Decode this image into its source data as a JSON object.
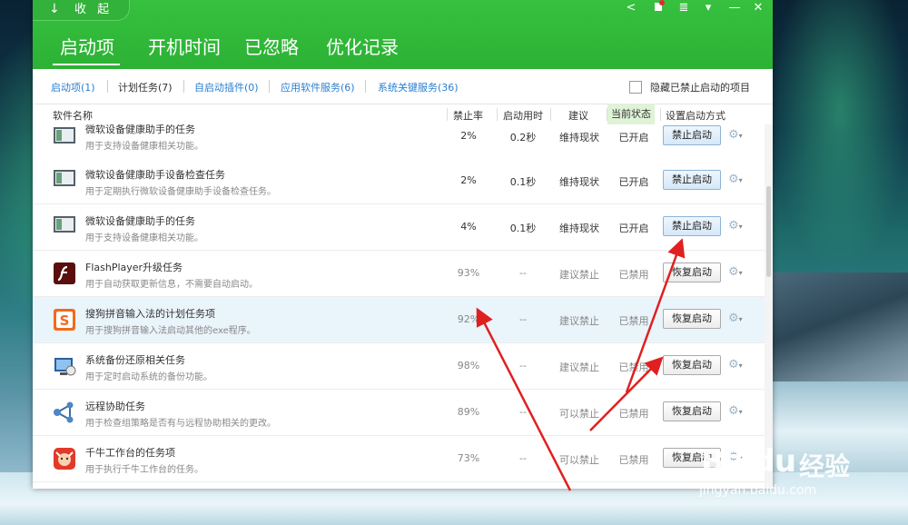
{
  "header": {
    "collapse_label": "收 起",
    "tabs": [
      {
        "label": "启动项"
      },
      {
        "label": "开机时间"
      },
      {
        "label": "已忽略"
      },
      {
        "label": "优化记录"
      }
    ],
    "controls": [
      "<",
      "",
      "≡",
      "▼",
      "—",
      "✕"
    ]
  },
  "filters": {
    "items": [
      {
        "label": "启动项(1)"
      },
      {
        "label": "计划任务(7)"
      },
      {
        "label": "自启动插件(0)"
      },
      {
        "label": "应用软件服务(6)"
      },
      {
        "label": "系统关键服务(36)"
      }
    ],
    "hide_checkbox_label": "隐藏已禁止启动的项目"
  },
  "columns": {
    "name": "软件名称",
    "ban_rate": "禁止率",
    "boot_time": "启动用时",
    "advice": "建议",
    "status": "当前状态",
    "action": "设置启动方式"
  },
  "rows": [
    {
      "title": "微软设备健康助手的任务",
      "desc": "用于支持设备健康相关功能。",
      "rate": "2%",
      "time": "0.2秒",
      "advice": "维持现状",
      "status": "已开启",
      "button": "禁止启动",
      "icon": "monitor-icon",
      "enabled": true
    },
    {
      "title": "微软设备健康助手设备检查任务",
      "desc": "用于定期执行微软设备健康助手设备检查任务。",
      "rate": "2%",
      "time": "0.1秒",
      "advice": "维持现状",
      "status": "已开启",
      "button": "禁止启动",
      "icon": "monitor-icon",
      "enabled": true
    },
    {
      "title": "微软设备健康助手的任务",
      "desc": "用于支持设备健康相关功能。",
      "rate": "4%",
      "time": "0.1秒",
      "advice": "维持现状",
      "status": "已开启",
      "button": "禁止启动",
      "icon": "monitor-icon",
      "enabled": true
    },
    {
      "title": "FlashPlayer升级任务",
      "desc": "用于自动获取更新信息，不需要自动启动。",
      "rate": "93%",
      "time": "--",
      "advice": "建议禁止",
      "status": "已禁用",
      "button": "恢复启动",
      "icon": "flash-icon",
      "enabled": false
    },
    {
      "title": "搜狗拼音输入法的计划任务项",
      "desc": "用于搜狗拼音输入法启动其他的exe程序。",
      "rate": "92%",
      "time": "--",
      "advice": "建议禁止",
      "status": "已禁用",
      "button": "恢复启动",
      "icon": "sogou-icon",
      "enabled": false
    },
    {
      "title": "系统备份还原相关任务",
      "desc": "用于定时启动系统的备份功能。",
      "rate": "98%",
      "time": "--",
      "advice": "建议禁止",
      "status": "已禁用",
      "button": "恢复启动",
      "icon": "backup-icon",
      "enabled": false
    },
    {
      "title": "远程协助任务",
      "desc": "用于检查组策略是否有与远程协助相关的更改。",
      "rate": "89%",
      "time": "--",
      "advice": "可以禁止",
      "status": "已禁用",
      "button": "恢复启动",
      "icon": "network-icon",
      "enabled": false
    },
    {
      "title": "千牛工作台的任务项",
      "desc": "用于执行千牛工作台的任务。",
      "rate": "73%",
      "time": "--",
      "advice": "可以禁止",
      "status": "已禁用",
      "button": "恢复启动",
      "icon": "qianniu-icon",
      "enabled": false
    }
  ],
  "watermark": {
    "brand": "Baidu",
    "cn": "经验",
    "url": "jingyan.baidu.com"
  },
  "colors": {
    "header_green": "#37c13f",
    "link_blue": "#2a7fd0",
    "arrow_red": "#e02020"
  }
}
